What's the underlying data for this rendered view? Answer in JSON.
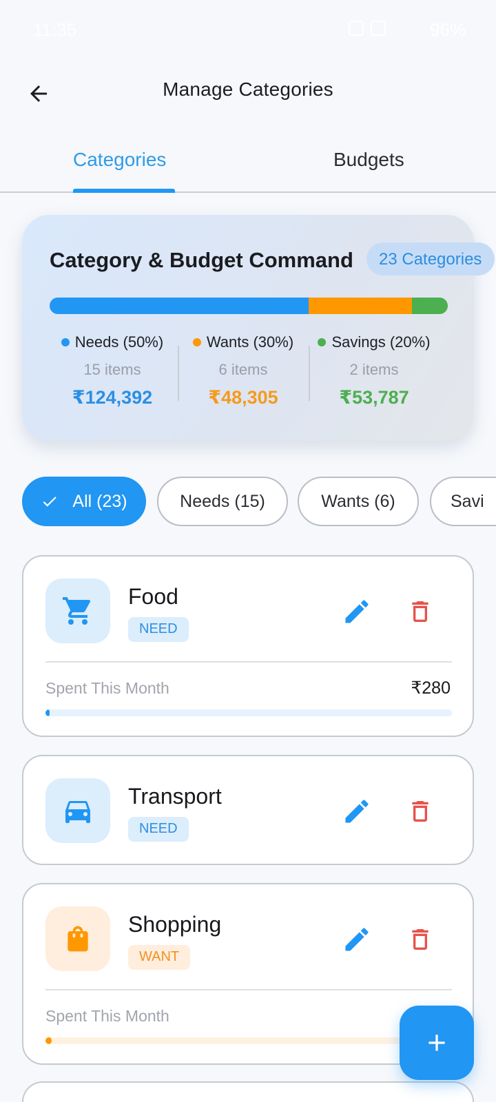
{
  "status_bar": {
    "time": "11:35",
    "battery": "96%"
  },
  "header": {
    "title": "Manage Categories"
  },
  "tabs": [
    {
      "label": "Categories",
      "active": true
    },
    {
      "label": "Budgets",
      "active": false
    }
  ],
  "summary": {
    "title": "Category & Budget Command",
    "badge": "23 Categories",
    "split": {
      "needs": 0.65,
      "wants": 0.26,
      "savings": 0.09
    },
    "groups": [
      {
        "label": "Needs (50%)",
        "count": "15 items",
        "amount": "₹124,392",
        "color": "#2196f3"
      },
      {
        "label": "Wants (30%)",
        "count": "6 items",
        "amount": "₹48,305",
        "color": "#ff9800"
      },
      {
        "label": "Savings (20%)",
        "count": "2 items",
        "amount": "₹53,787",
        "color": "#4caf50"
      }
    ]
  },
  "filters": [
    {
      "label": "All (23)",
      "active": true
    },
    {
      "label": "Needs (15)",
      "active": false
    },
    {
      "label": "Wants (6)",
      "active": false
    },
    {
      "label": "Savi",
      "active": false
    }
  ],
  "categories": [
    {
      "name": "Food",
      "tag": "NEED",
      "icon": "cart-icon",
      "spent_label": "Spent This Month",
      "spent": "₹280",
      "progress": 0.003,
      "color": "#2196f3"
    },
    {
      "name": "Transport",
      "tag": "NEED",
      "icon": "car-icon"
    },
    {
      "name": "Shopping",
      "tag": "WANT",
      "icon": "shopping-bag-icon",
      "spent_label": "Spent This Month",
      "progress": 0.015,
      "color": "#ff9800"
    }
  ],
  "colors": {
    "accent": "#2196f3",
    "want": "#ff9800",
    "saving": "#4caf50",
    "delete": "#e5534b"
  }
}
